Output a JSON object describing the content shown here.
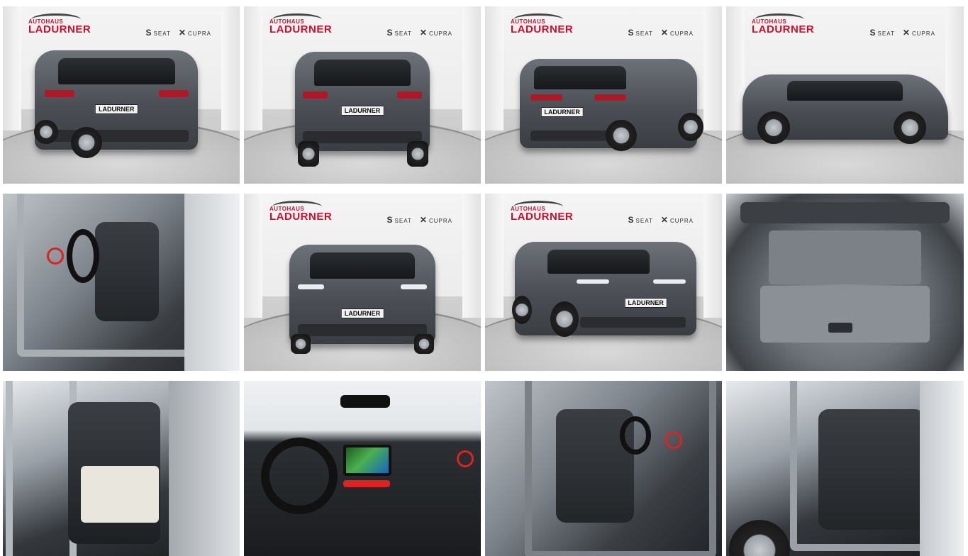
{
  "gallery": {
    "dealer_logo": {
      "small": "AUTOHAUS",
      "big": "LADURNER"
    },
    "brand_marks": {
      "seat_mark": "S",
      "seat_text": "SEAT",
      "cupra_mark": "✕",
      "cupra_text": "CUPRA"
    },
    "plate_text": "LADURNER",
    "tiles": [
      {
        "id": 1,
        "view": "rear-left"
      },
      {
        "id": 2,
        "view": "rear"
      },
      {
        "id": 3,
        "view": "rear-right"
      },
      {
        "id": 4,
        "view": "side"
      },
      {
        "id": 5,
        "view": "driver-door-interior"
      },
      {
        "id": 6,
        "view": "front"
      },
      {
        "id": 7,
        "view": "front-left"
      },
      {
        "id": 8,
        "view": "trunk"
      },
      {
        "id": 9,
        "view": "rear-seat-left"
      },
      {
        "id": 10,
        "view": "dashboard"
      },
      {
        "id": 11,
        "view": "front-seat-passenger"
      },
      {
        "id": 12,
        "view": "rear-seat-right"
      }
    ]
  },
  "colors": {
    "logo_red": "#c8102e",
    "car_grey": "#4b4f55"
  }
}
